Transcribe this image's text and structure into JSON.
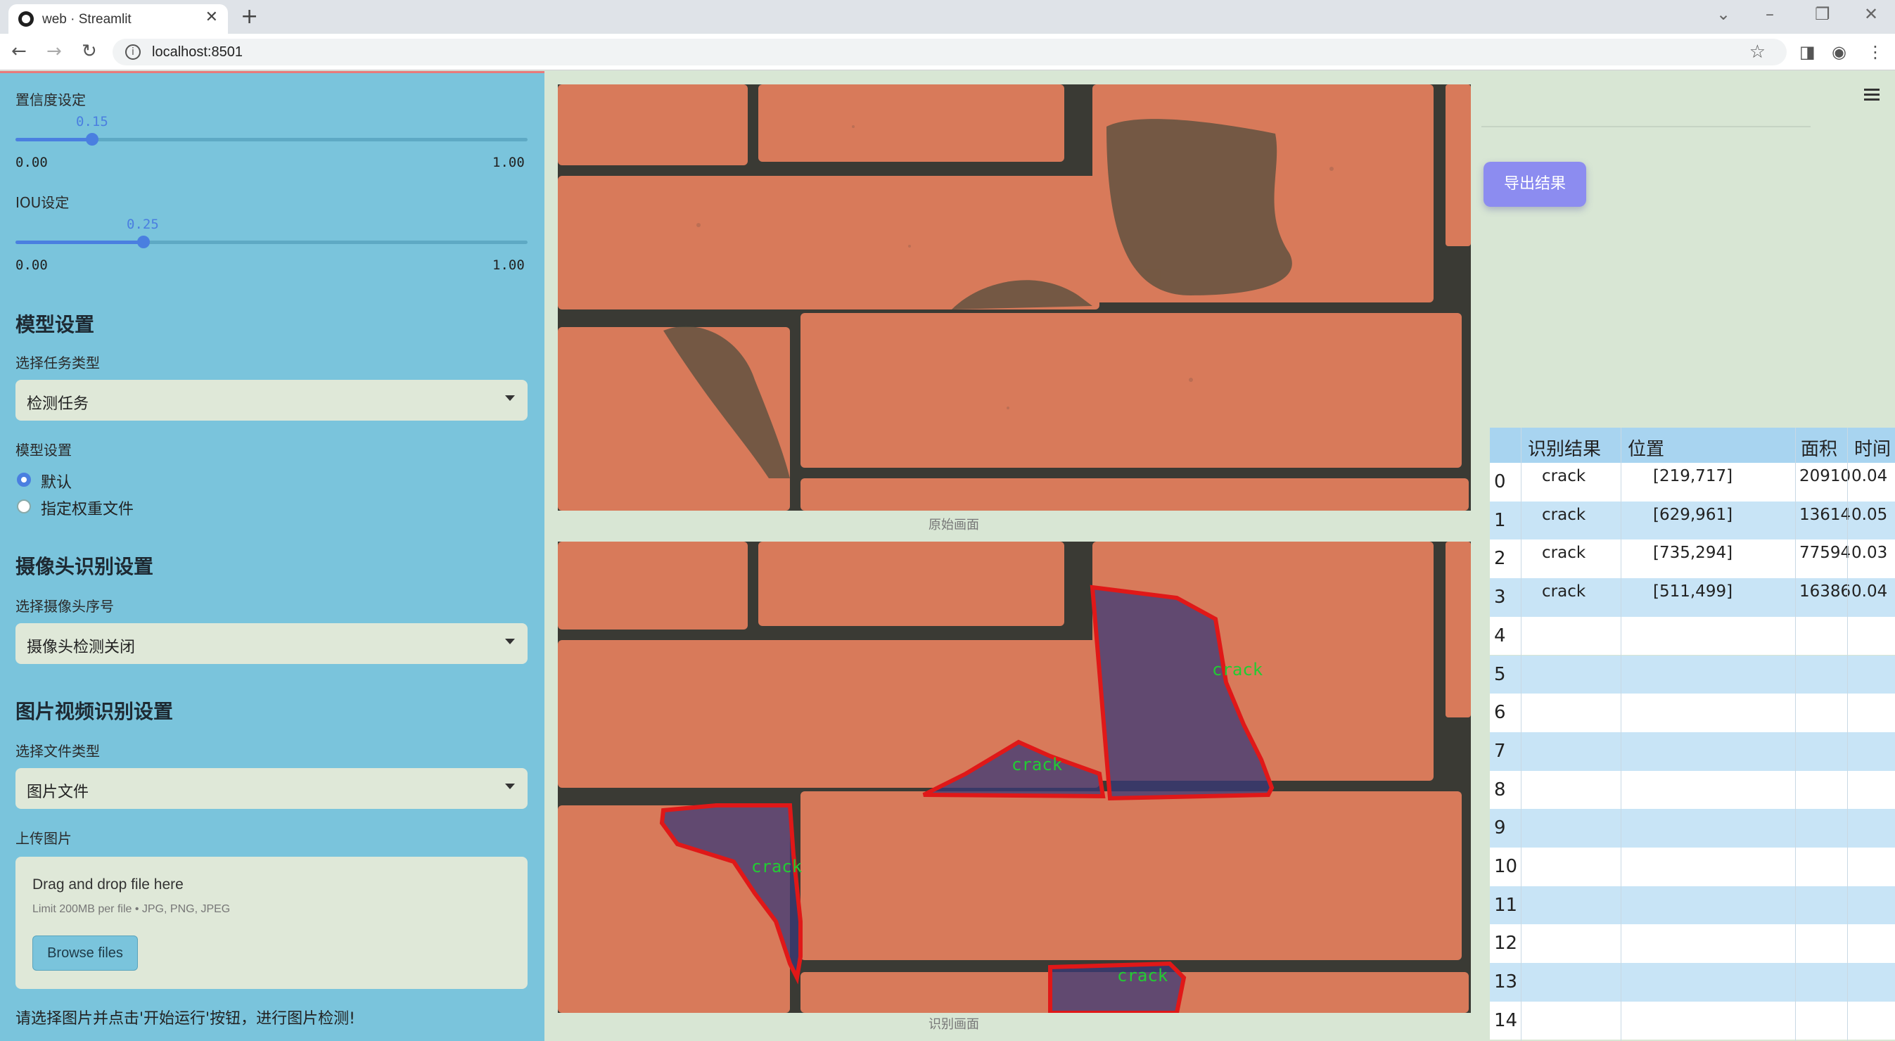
{
  "browser": {
    "tab_title": "web · Streamlit",
    "url": "localhost:8501"
  },
  "sidebar": {
    "confidence": {
      "label": "置信度设定",
      "value": "0.15",
      "value_num": 0.15,
      "min": "0.00",
      "max": "1.00"
    },
    "iou": {
      "label": "IOU设定",
      "value": "0.25",
      "value_num": 0.25,
      "min": "0.00",
      "max": "1.00"
    },
    "model_section": {
      "title": "模型设置",
      "task_label": "选择任务类型",
      "task_value": "检测任务",
      "model_label": "模型设置",
      "options": [
        "默认",
        "指定权重文件"
      ],
      "selected": "默认"
    },
    "camera_section": {
      "title": "摄像头识别设置",
      "cam_label": "选择摄像头序号",
      "cam_value": "摄像头检测关闭"
    },
    "media_section": {
      "title": "图片视频识别设置",
      "type_label": "选择文件类型",
      "type_value": "图片文件",
      "upload_label": "上传图片",
      "drop_title": "Drag and drop file here",
      "drop_limit": "Limit 200MB per file • JPG, PNG, JPEG",
      "browse_label": "Browse files"
    },
    "footer_note": "请选择图片并点击'开始运行'按钮，进行图片检测!"
  },
  "main": {
    "original_caption": "原始画面",
    "result_caption": "识别画面",
    "detection_label": "crack",
    "export_label": "导出结果"
  },
  "table": {
    "headers": [
      "识别结果",
      "位置",
      "面积",
      "时间"
    ],
    "rows": [
      {
        "idx": "0",
        "result": "crack",
        "pos": "[219,717]",
        "area": "20910",
        "time": "0.04"
      },
      {
        "idx": "1",
        "result": "crack",
        "pos": "[629,961]",
        "area": "13614",
        "time": "0.05"
      },
      {
        "idx": "2",
        "result": "crack",
        "pos": "[735,294]",
        "area": "77594",
        "time": "0.03"
      },
      {
        "idx": "3",
        "result": "crack",
        "pos": "[511,499]",
        "area": "16386",
        "time": "0.04"
      },
      {
        "idx": "4",
        "result": "",
        "pos": "",
        "area": "",
        "time": ""
      },
      {
        "idx": "5",
        "result": "",
        "pos": "",
        "area": "",
        "time": ""
      },
      {
        "idx": "6",
        "result": "",
        "pos": "",
        "area": "",
        "time": ""
      },
      {
        "idx": "7",
        "result": "",
        "pos": "",
        "area": "",
        "time": ""
      },
      {
        "idx": "8",
        "result": "",
        "pos": "",
        "area": "",
        "time": ""
      },
      {
        "idx": "9",
        "result": "",
        "pos": "",
        "area": "",
        "time": ""
      },
      {
        "idx": "10",
        "result": "",
        "pos": "",
        "area": "",
        "time": ""
      },
      {
        "idx": "11",
        "result": "",
        "pos": "",
        "area": "",
        "time": ""
      },
      {
        "idx": "12",
        "result": "",
        "pos": "",
        "area": "",
        "time": ""
      },
      {
        "idx": "13",
        "result": "",
        "pos": "",
        "area": "",
        "time": ""
      },
      {
        "idx": "14",
        "result": "",
        "pos": "",
        "area": "",
        "time": ""
      }
    ]
  },
  "colors": {
    "sidebar_bg": "#7ac4dc",
    "accent": "#4a7fe0",
    "brick": "#d87a5a",
    "mortar": "#3a3a34",
    "detect_box": "#e01818",
    "detect_fill": "#3a3a78",
    "detect_text": "#22cc33",
    "table_header": "#a8d4f0",
    "table_alt": "#c8e4f6"
  }
}
